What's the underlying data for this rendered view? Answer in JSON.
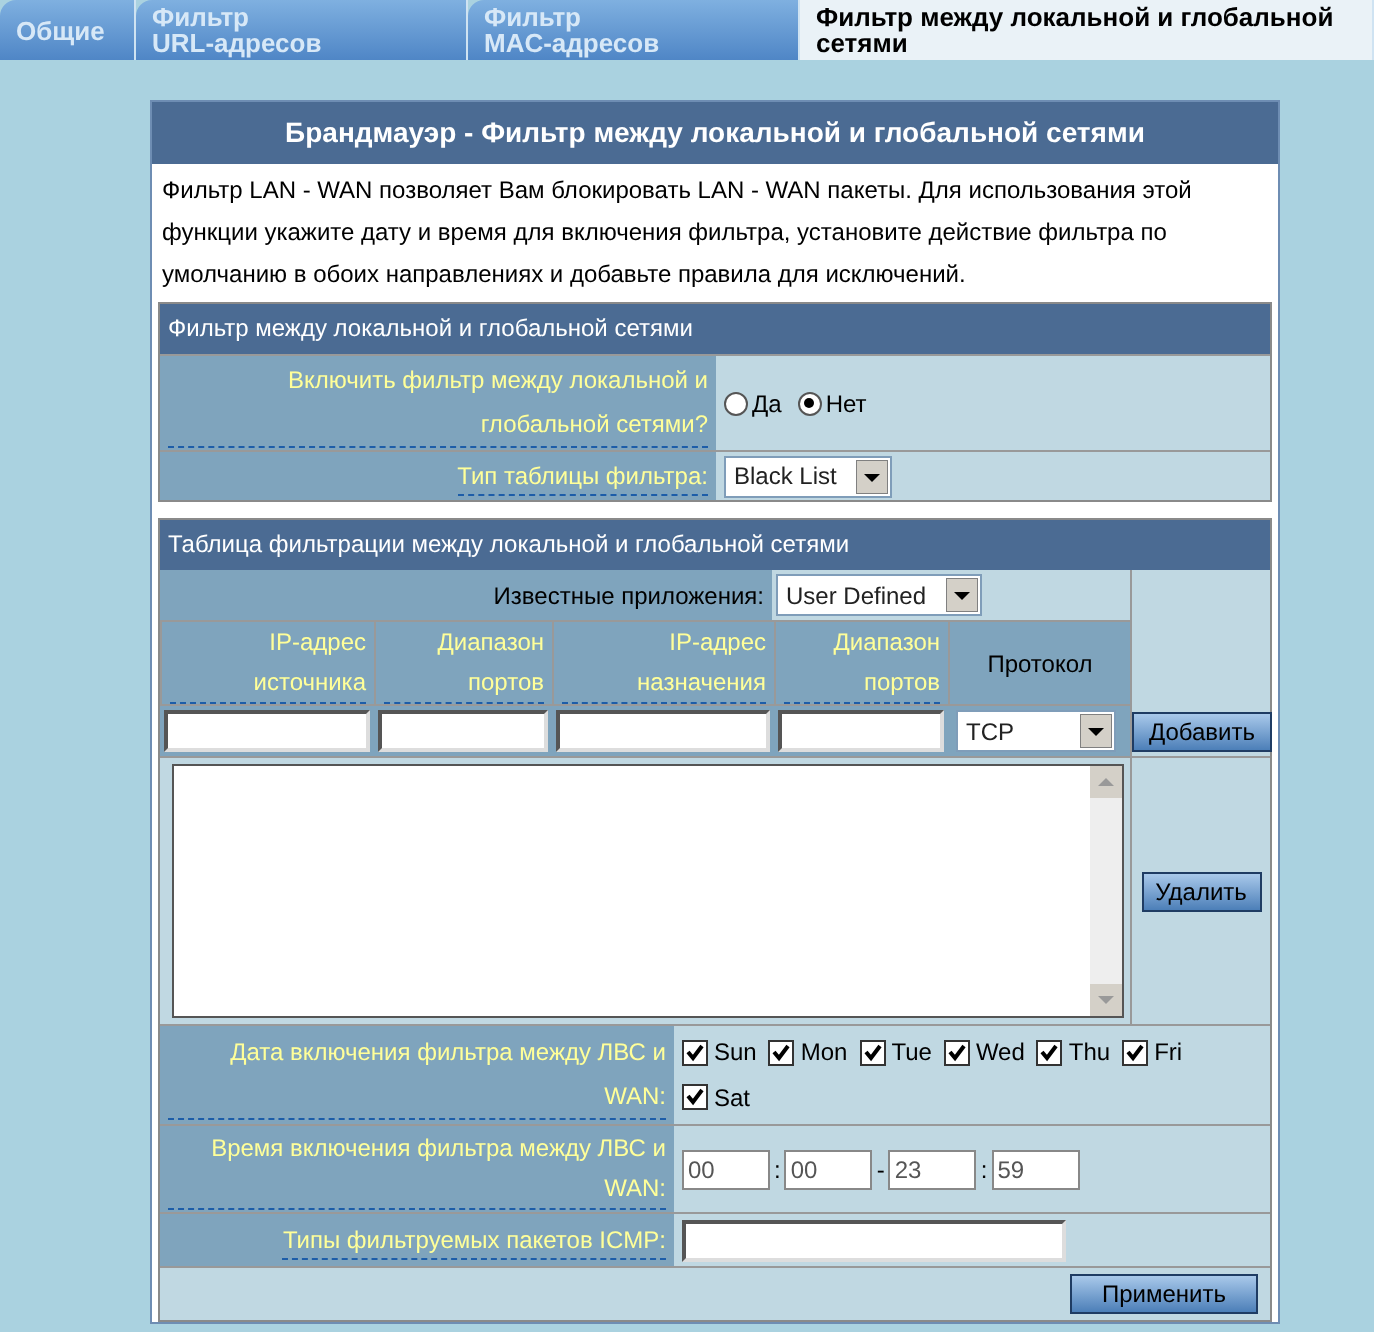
{
  "tabs": [
    {
      "label": "Общие",
      "selected": false
    },
    {
      "label": "Фильтр\nURL-адресов",
      "selected": false
    },
    {
      "label": "Фильтр\nMAC-адресов",
      "selected": false
    },
    {
      "label": "Фильтр между локальной и глобальной\nсетями",
      "selected": true
    }
  ],
  "panel": {
    "title": "Брандмауэр - Фильтр между локальной и глобальной сетями",
    "description": "Фильтр LAN - WAN позволяет Вам блокировать LAN - WAN пакеты. Для использования этой функции укажите дату и время для включения фильтра, установите действие фильтра по умолчанию в обоих направлениях и добавьте правила для исключений."
  },
  "settings": {
    "header": "Фильтр между локальной и глобальной сетями",
    "enable_label": "Включить фильтр между локальной и глобальной сетями?",
    "enable_options": [
      {
        "label": "Да",
        "selected": false
      },
      {
        "label": "Нет",
        "selected": true
      }
    ],
    "type_label": "Тип таблицы фильтра:",
    "type_value": "Black List"
  },
  "table": {
    "header": "Таблица фильтрации между локальной и глобальной сетями",
    "apps_label": "Известные приложения:",
    "apps_value": "User Defined",
    "columns": [
      {
        "label": "IP-адрес источника",
        "kind": "hint"
      },
      {
        "label": "Диапазон портов",
        "kind": "hint"
      },
      {
        "label": "IP-адрес назначения",
        "kind": "hint"
      },
      {
        "label": "Диапазон портов",
        "kind": "hint"
      },
      {
        "label": "Протокол",
        "kind": "plain"
      }
    ],
    "protocol_value": "TCP",
    "add_button": "Добавить",
    "delete_button": "Удалить"
  },
  "schedule": {
    "days_label": "Дата включения фильтра между ЛВС и WAN:",
    "days": [
      {
        "label": "Sun",
        "checked": true
      },
      {
        "label": "Mon",
        "checked": true
      },
      {
        "label": "Tue",
        "checked": true
      },
      {
        "label": "Wed",
        "checked": true
      },
      {
        "label": "Thu",
        "checked": true
      },
      {
        "label": "Fri",
        "checked": true
      },
      {
        "label": "Sat",
        "checked": true
      }
    ],
    "time_label": "Время включения фильтра между ЛВС и WAN:",
    "time_parts": [
      {
        "value": "00",
        "sep": ":"
      },
      {
        "value": "00",
        "sep": "-"
      },
      {
        "value": "23",
        "sep": ":"
      },
      {
        "value": "59"
      }
    ],
    "icmp_label": "Типы фильтруемых пакетов ICMP:"
  },
  "apply_button": "Применить"
}
